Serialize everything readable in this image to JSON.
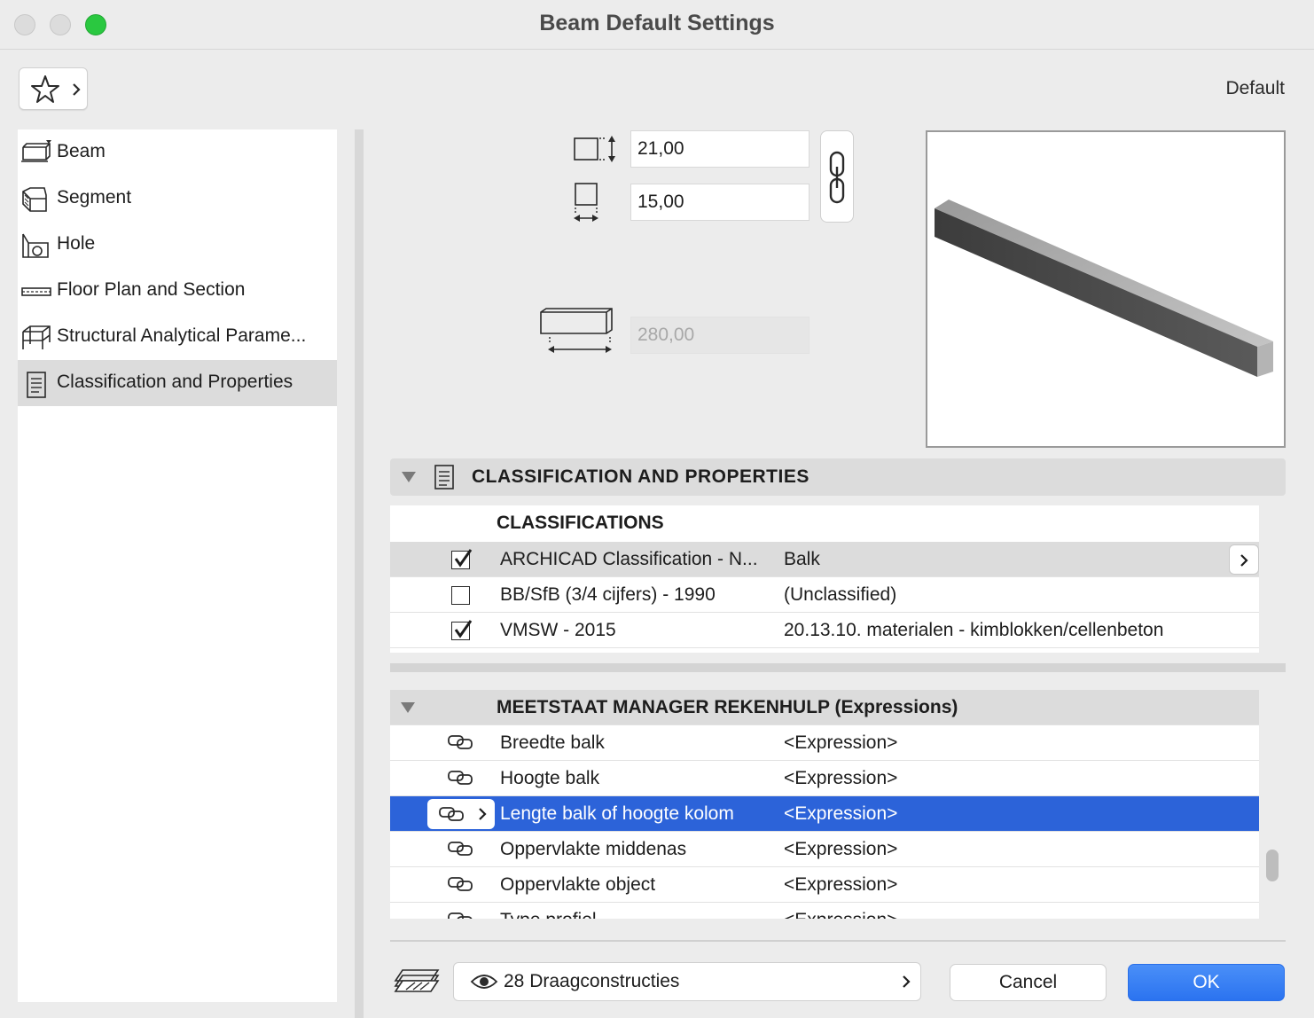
{
  "window": {
    "title": "Beam Default Settings"
  },
  "header": {
    "favorites_icon": "star-icon",
    "default_label": "Default"
  },
  "sidebar": {
    "items": [
      {
        "label": "Beam",
        "icon": "beam-icon"
      },
      {
        "label": "Segment",
        "icon": "segment-icon"
      },
      {
        "label": "Hole",
        "icon": "hole-icon"
      },
      {
        "label": "Floor Plan and Section",
        "icon": "floor-plan-icon"
      },
      {
        "label": "Structural Analytical Parame...",
        "icon": "structural-icon"
      },
      {
        "label": "Classification and Properties",
        "icon": "document-icon",
        "selected": true
      }
    ]
  },
  "dimensions": {
    "height": "21,00",
    "width": "15,00",
    "length": "280,00"
  },
  "section": {
    "title": "CLASSIFICATION AND PROPERTIES"
  },
  "classifications": {
    "title": "CLASSIFICATIONS",
    "rows": [
      {
        "checked": true,
        "name": "ARCHICAD Classification - N...",
        "value": "Balk"
      },
      {
        "checked": false,
        "name": "BB/SfB (3/4 cijfers) - 1990",
        "value": "(Unclassified)"
      },
      {
        "checked": true,
        "name": "VMSW - 2015",
        "value": "20.13.10. materialen - kimblokken/cellenbeton"
      }
    ]
  },
  "expressions": {
    "title": "MEETSTAAT MANAGER REKENHULP (Expressions)",
    "rows": [
      {
        "name": "Breedte balk",
        "value": "<Expression>"
      },
      {
        "name": "Hoogte balk",
        "value": "<Expression>"
      },
      {
        "name": "Lengte balk of hoogte kolom",
        "value": "<Expression>",
        "selected": true
      },
      {
        "name": "Oppervlakte middenas",
        "value": "<Expression>"
      },
      {
        "name": "Oppervlakte object",
        "value": "<Expression>"
      },
      {
        "name": "Type profiel",
        "value": "<Expression>"
      }
    ]
  },
  "footer": {
    "layer": "28 Draagconstructies",
    "cancel": "Cancel",
    "ok": "OK"
  },
  "colors": {
    "selection": "#2c63d9",
    "ok_button": "#2b73f0",
    "zoom_button": "#2ac840"
  }
}
